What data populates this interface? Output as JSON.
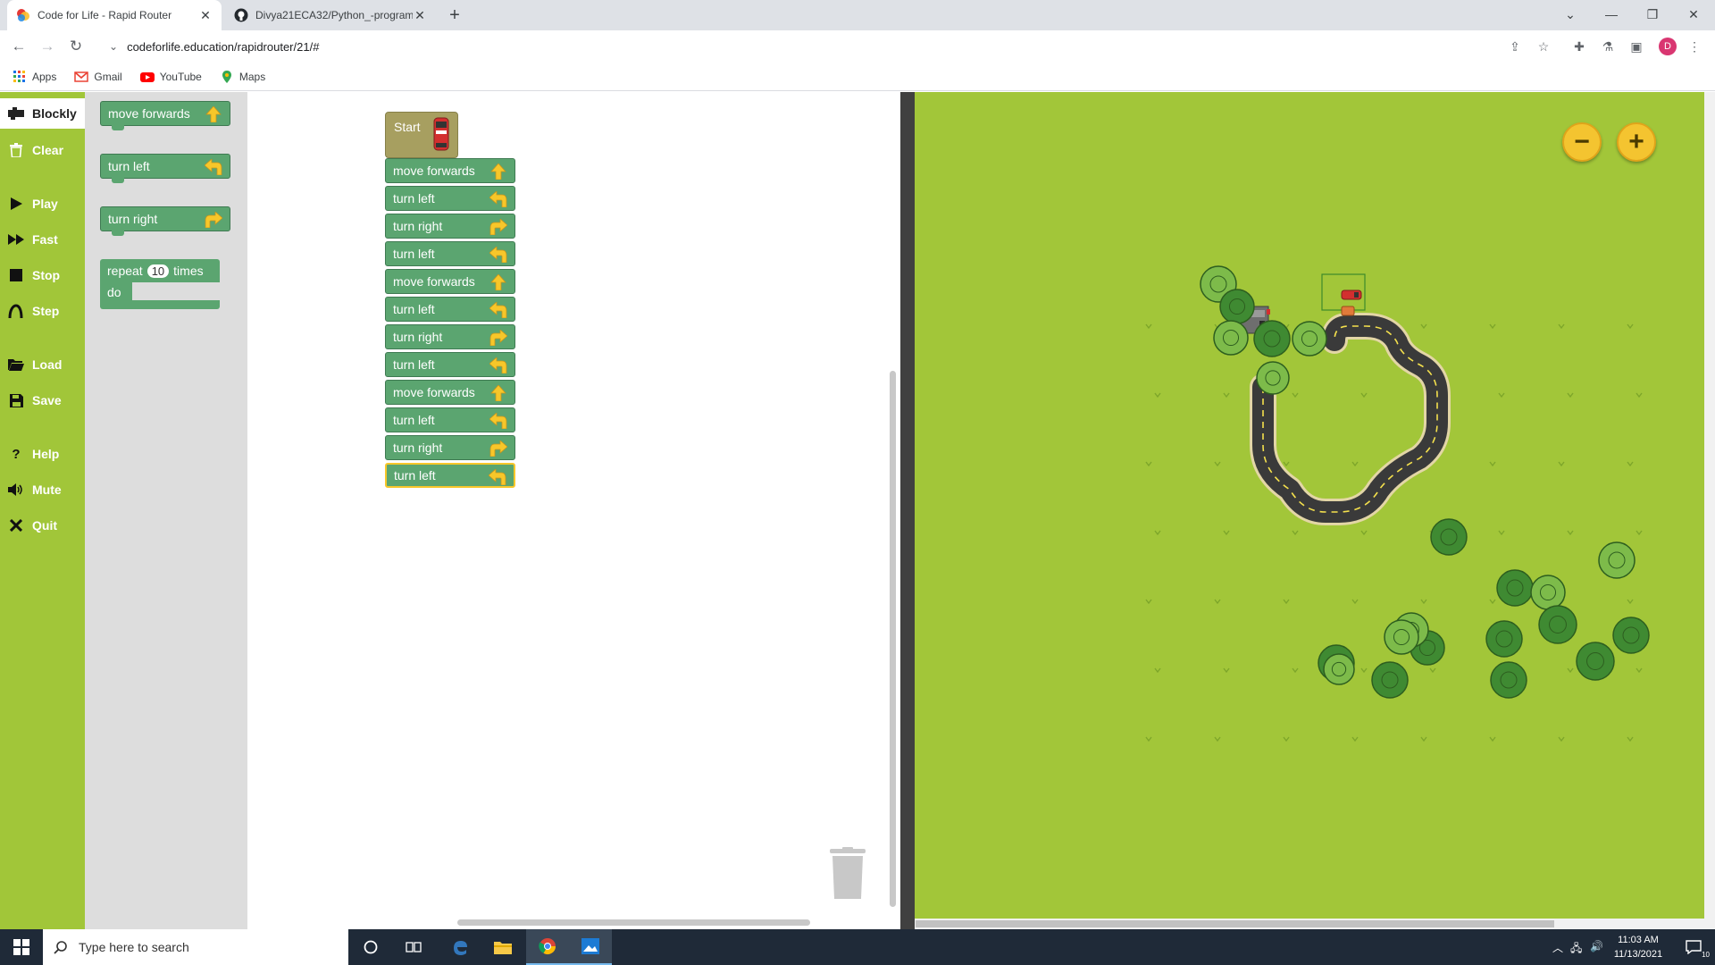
{
  "browser": {
    "tabs": [
      {
        "title": "Code for Life - Rapid Router",
        "active": true
      },
      {
        "title": "Divya21ECA32/Python_-program",
        "active": false
      }
    ],
    "new_tab_symbol": "+",
    "close_symbol": "✕",
    "url": "codeforlife.education/rapidrouter/21/#",
    "bookmarks": [
      {
        "label": "Apps",
        "icon": "apps-grid-icon"
      },
      {
        "label": "Gmail",
        "icon": "gmail-icon"
      },
      {
        "label": "YouTube",
        "icon": "youtube-icon"
      },
      {
        "label": "Maps",
        "icon": "maps-icon"
      }
    ],
    "profile_initial": "D"
  },
  "sidebar": {
    "items": [
      {
        "label": "Blockly",
        "icon": "blockly-icon",
        "active": true
      },
      {
        "label": "Clear",
        "icon": "trash-icon"
      },
      {
        "label": "Play",
        "icon": "play-icon"
      },
      {
        "label": "Fast",
        "icon": "fast-forward-icon"
      },
      {
        "label": "Stop",
        "icon": "stop-icon"
      },
      {
        "label": "Step",
        "icon": "step-icon"
      },
      {
        "label": "Load",
        "icon": "folder-icon"
      },
      {
        "label": "Save",
        "icon": "save-icon"
      },
      {
        "label": "Help",
        "icon": "help-icon"
      },
      {
        "label": "Mute",
        "icon": "speaker-icon"
      },
      {
        "label": "Quit",
        "icon": "close-icon"
      }
    ]
  },
  "toolbox": {
    "blocks": [
      {
        "label": "move forwards",
        "icon": "arrow-up-icon"
      },
      {
        "label": "turn left",
        "icon": "arrow-left-icon"
      },
      {
        "label": "turn right",
        "icon": "arrow-right-icon"
      }
    ],
    "repeat": {
      "label": "repeat",
      "count": "10",
      "suffix": "times",
      "do_label": "do"
    }
  },
  "workspace": {
    "start_label": "Start",
    "program": [
      {
        "label": "move forwards",
        "icon": "arrow-up-icon"
      },
      {
        "label": "turn left",
        "icon": "arrow-left-icon"
      },
      {
        "label": "turn right",
        "icon": "arrow-right-icon"
      },
      {
        "label": "turn left",
        "icon": "arrow-left-icon"
      },
      {
        "label": "move forwards",
        "icon": "arrow-up-icon"
      },
      {
        "label": "turn left",
        "icon": "arrow-left-icon"
      },
      {
        "label": "turn right",
        "icon": "arrow-right-icon"
      },
      {
        "label": "turn left",
        "icon": "arrow-left-icon"
      },
      {
        "label": "move forwards",
        "icon": "arrow-up-icon"
      },
      {
        "label": "turn left",
        "icon": "arrow-left-icon"
      },
      {
        "label": "turn right",
        "icon": "arrow-right-icon"
      },
      {
        "label": "turn left",
        "icon": "arrow-left-icon",
        "selected": true
      }
    ]
  },
  "map": {
    "zoom_out_symbol": "−",
    "zoom_in_symbol": "+"
  },
  "taskbar": {
    "search_placeholder": "Type here to search",
    "time": "11:03 AM",
    "date": "11/13/2021",
    "notification_count": "10"
  },
  "colors": {
    "sidebar_green": "#a1c639",
    "block_green": "#5ba570",
    "start_block": "#a79f60",
    "arrow_yellow": "#f7c72a",
    "map_grass": "#a2c639"
  }
}
